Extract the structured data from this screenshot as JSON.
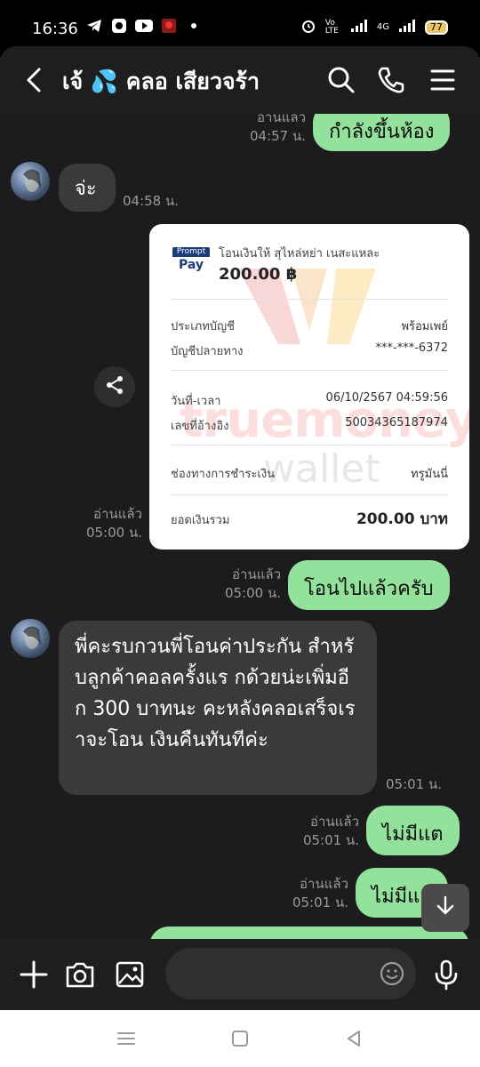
{
  "status_bar": {
    "time": "16:36",
    "battery": "77",
    "network": "4G",
    "volte": "Vo LTE"
  },
  "header": {
    "title": "เจ้ 💦 คลอ เสียวจร้า"
  },
  "messages": [
    {
      "type": "out",
      "text": "กำลังขึ้นห้อง",
      "read": "อ่านแล้ว",
      "time": "04:57 น."
    },
    {
      "type": "in",
      "text": "จ่ะ",
      "time": "04:58 น."
    },
    {
      "type": "out-image",
      "read": "อ่านแล้ว",
      "time": "05:00 น."
    },
    {
      "type": "out",
      "text": "โอนไปแล้วครับ",
      "read": "อ่านแล้ว",
      "time": "05:00 น."
    },
    {
      "type": "in",
      "text": "พี่คะรบกวนพี่โอนค่าประกัน สำหรับลูกค้าคอลครั้งแร กด้วยน่ะเพิ่มอีก 300 บาทนะ คะหลังคลอเสร็จเราจะโอน เงินคืนทันทีค่ะ",
      "time": "05:01 น."
    },
    {
      "type": "out",
      "text": "ไม่มีแต",
      "read": "อ่านแล้ว",
      "time": "05:01 น."
    },
    {
      "type": "out",
      "text": "ไม่มีแล",
      "read": "อ่านแล้ว",
      "time": "05:01 น."
    }
  ],
  "receipt": {
    "logo_top": "Prompt",
    "logo_bottom": "Pay",
    "transfer_to": "โอนเงินให้ สุไหล่หย่า เนสะแหละ",
    "amount": "200.00 ฿",
    "account_type_label": "ประเภทบัญชี",
    "account_type_value": "พร้อมเพย์",
    "dest_account_label": "บัญชีปลายทาง",
    "dest_account_value": "***-***-6372",
    "datetime_label": "วันที่-เวลา",
    "datetime_value": "06/10/2567 04:59:56",
    "ref_label": "เลขที่อ้างอิง",
    "ref_value": "50034365187974",
    "channel_label": "ช่องทางการชำระเงิน",
    "channel_value": "ทรูมันนี่",
    "total_label": "ยอดเงินรวม",
    "total_value": "200.00 บาท",
    "watermark_brand": "truemoney",
    "watermark_sub": "wallet"
  },
  "input": {
    "placeholder": ""
  },
  "colors": {
    "outgoing_bubble": "#93e29b",
    "incoming_bubble": "#3a3a3c",
    "background": "#1c1c1e"
  }
}
